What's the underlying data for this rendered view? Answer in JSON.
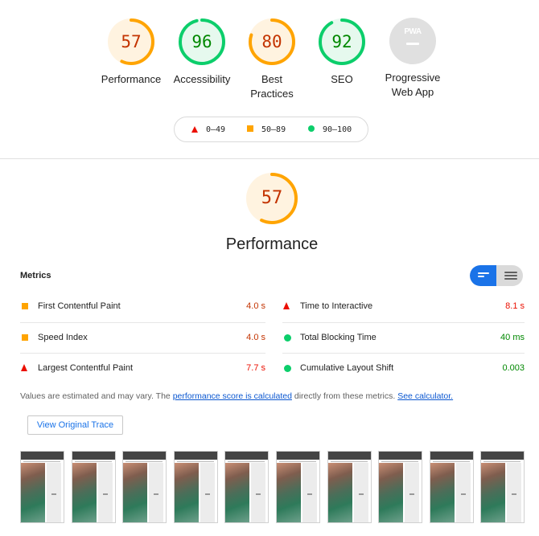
{
  "categories": [
    {
      "score": "57",
      "label_line1": "Performance",
      "label_line2": "",
      "color": "#ffa400",
      "text_color": "#c33300",
      "bg": "#fff3e0",
      "fraction": 0.57
    },
    {
      "score": "96",
      "label_line1": "Accessibility",
      "label_line2": "",
      "color": "#0cce6b",
      "text_color": "#008800",
      "bg": "#e6f9ee",
      "fraction": 0.96
    },
    {
      "score": "80",
      "label_line1": "Best",
      "label_line2": "Practices",
      "color": "#ffa400",
      "text_color": "#c33300",
      "bg": "#fff3e0",
      "fraction": 0.8
    },
    {
      "score": "92",
      "label_line1": "SEO",
      "label_line2": "",
      "color": "#0cce6b",
      "text_color": "#008800",
      "bg": "#e6f9ee",
      "fraction": 0.92
    },
    {
      "score": "PWA",
      "label_line1": "Progressive",
      "label_line2": "Web App",
      "color": "#e0e0e0",
      "text_color": "#ffffff",
      "bg": "#e0e0e0",
      "fraction": 0
    }
  ],
  "legend": {
    "fail": "0–49",
    "average": "50–89",
    "pass": "90–100"
  },
  "performance": {
    "score": "57",
    "fraction": 0.57,
    "title": "Performance"
  },
  "metrics": {
    "title": "Metrics",
    "left": [
      {
        "name": "First Contentful Paint",
        "value": "4.0 s",
        "rating": "average"
      },
      {
        "name": "Speed Index",
        "value": "4.0 s",
        "rating": "average"
      },
      {
        "name": "Largest Contentful Paint",
        "value": "7.7 s",
        "rating": "fail"
      }
    ],
    "right": [
      {
        "name": "Time to Interactive",
        "value": "8.1 s",
        "rating": "fail"
      },
      {
        "name": "Total Blocking Time",
        "value": "40 ms",
        "rating": "pass"
      },
      {
        "name": "Cumulative Layout Shift",
        "value": "0.003",
        "rating": "pass"
      }
    ]
  },
  "note": {
    "prefix": "Values are estimated and may vary. The ",
    "link1": "performance score is calculated",
    "middle": " directly from these metrics. ",
    "link2": "See calculator."
  },
  "trace_button": "View Original Trace",
  "rating_colors": {
    "fail": "#eb0f00",
    "average": "#c33300",
    "pass": "#008800"
  }
}
